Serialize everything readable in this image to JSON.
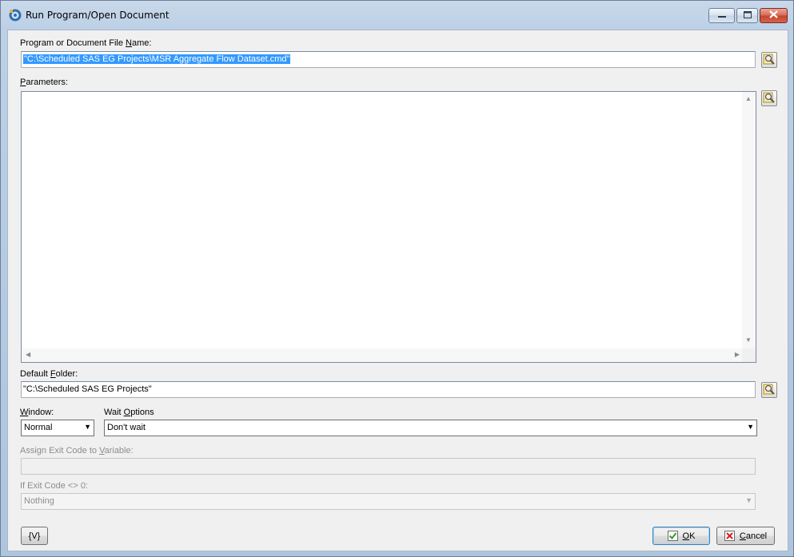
{
  "window": {
    "title": "Run Program/Open Document",
    "icon": "run-program-icon",
    "controls": {
      "minimize": "minimize-icon",
      "maximize": "maximize-icon",
      "close": "close-icon"
    }
  },
  "program": {
    "label_pre": "Program or Document File ",
    "label_key": "N",
    "label_post": "ame:",
    "value": "\"C:\\Scheduled SAS EG Projects\\MSR Aggregate Flow Dataset.cmd\"",
    "browse_icon": "browse-icon"
  },
  "parameters": {
    "label_key": "P",
    "label_post": "arameters:",
    "value": "",
    "browse_icon": "browse-icon"
  },
  "default_folder": {
    "label_pre": "Default ",
    "label_key": "F",
    "label_post": "older:",
    "value": "\"C:\\Scheduled SAS EG Projects\"",
    "browse_icon": "browse-icon"
  },
  "window_mode": {
    "label_key": "W",
    "label_post": "indow:",
    "selected": "Normal"
  },
  "wait_options": {
    "label_pre": "Wait ",
    "label_key": "O",
    "label_post": "ptions",
    "selected": "Don't wait"
  },
  "exit_variable": {
    "label_pre": "Assign Exit Code to ",
    "label_key": "V",
    "label_post": "ariable:",
    "value": ""
  },
  "exit_code": {
    "label": "If Exit Code <> 0:",
    "selected": "Nothing"
  },
  "buttons": {
    "variable": "{V}",
    "ok_key": "O",
    "ok_post": "K",
    "cancel_key": "C",
    "cancel_post": "ancel"
  },
  "colors": {
    "selection": "#3399ff",
    "ok_check": "#2e9a2e",
    "cancel_x": "#d21f1f"
  }
}
